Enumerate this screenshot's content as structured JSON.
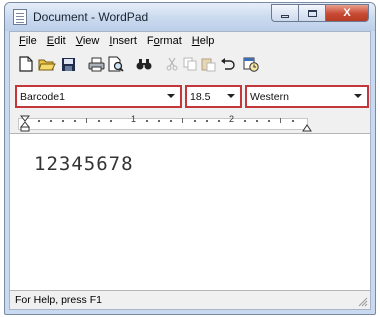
{
  "window": {
    "title": "Document - WordPad"
  },
  "caption": {
    "close_glyph": "X"
  },
  "menu": [
    {
      "first": "F",
      "rest": "ile"
    },
    {
      "first": "E",
      "rest": "dit"
    },
    {
      "first": "V",
      "rest": "iew"
    },
    {
      "first": "I",
      "rest": "nsert"
    },
    {
      "pre": "F",
      "ul": "o",
      "post": "rmat"
    },
    {
      "first": "H",
      "rest": "elp"
    }
  ],
  "toolbar": {
    "icons": [
      "new-document-icon",
      "open-folder-icon",
      "save-icon",
      "print-icon",
      "print-preview-icon",
      "find-icon",
      "cut-icon",
      "copy-icon",
      "paste-icon",
      "undo-icon",
      "insert-date-time-icon"
    ]
  },
  "format": {
    "font_name": "Barcode1",
    "font_size": "18.5",
    "script": "Western"
  },
  "ruler": {
    "labels": [
      "1",
      "2"
    ]
  },
  "document": {
    "text": "12345678"
  },
  "status": {
    "text": "For Help, press F1"
  },
  "colors": {
    "highlight_outline": "#c3363a",
    "title_bar": "#c9daf0",
    "close_button": "#c74a33"
  }
}
